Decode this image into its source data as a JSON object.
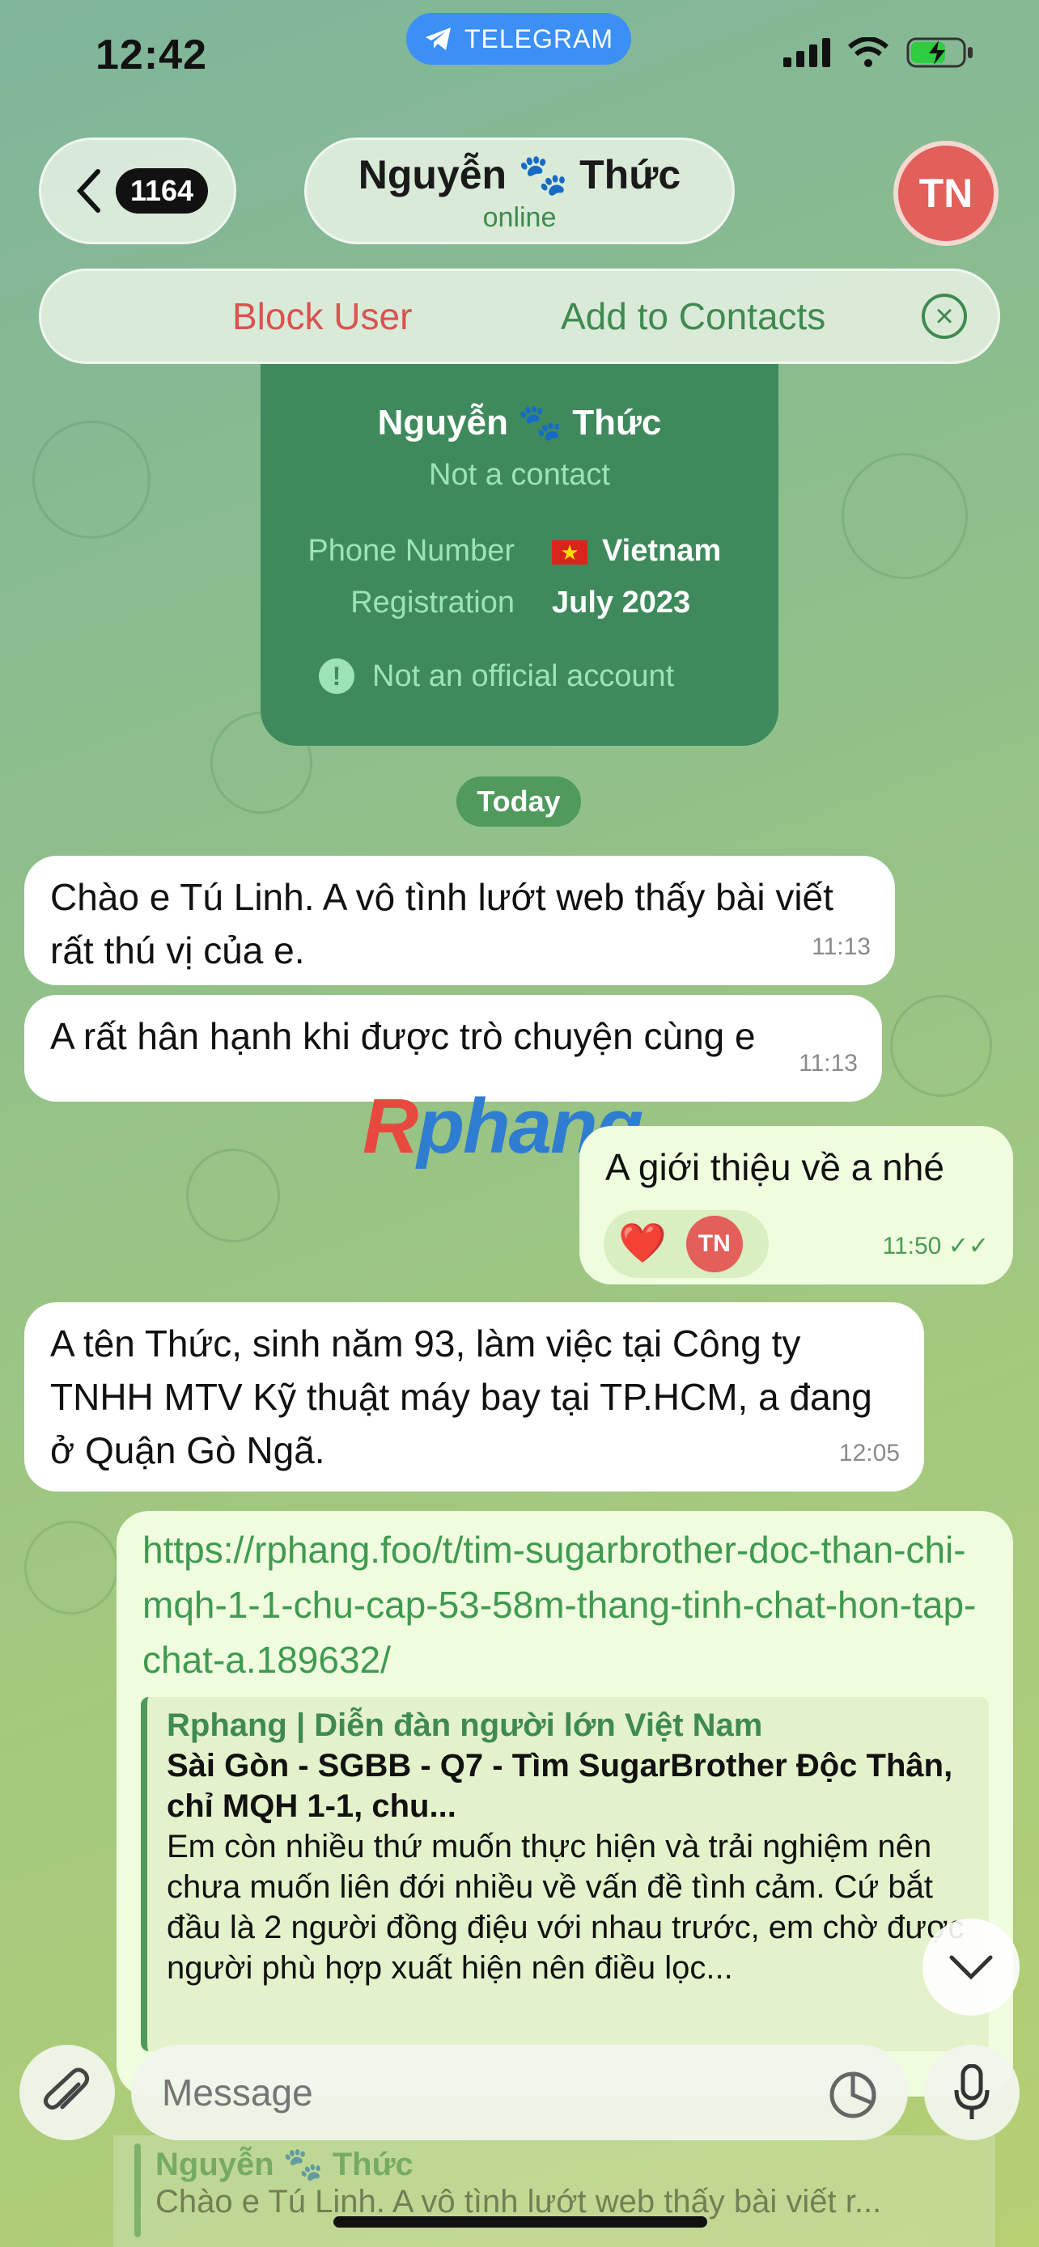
{
  "status_bar": {
    "time": "12:42",
    "app_pill": "TELEGRAM"
  },
  "header": {
    "unread_count": "1164",
    "contact_name": "Nguyễn 🐾 Thức",
    "contact_status": "online",
    "avatar_initials": "TN"
  },
  "action_bar": {
    "block_label": "Block User",
    "add_label": "Add to Contacts"
  },
  "info_card": {
    "name": "Nguyễn 🐾 Thức",
    "subtitle": "Not a contact",
    "phone_label": "Phone Number",
    "phone_value": "Vietnam",
    "registration_label": "Registration",
    "registration_value": "July 2023",
    "official_note": "Not an official account"
  },
  "date_separator": "Today",
  "messages": [
    {
      "text": "Chào e Tú Linh. A vô tình lướt web thấy bài viết rất thú vị của e.",
      "time": "11:13"
    },
    {
      "text": "A rất hân hạnh khi được trò chuyện cùng e",
      "time": "11:13"
    },
    {
      "text": "A giới thiệu về a nhé",
      "time": "11:50",
      "reaction": "❤️",
      "reaction_initials": "TN"
    },
    {
      "text": "A tên Thức, sinh năm 93, làm việc tại Công ty TNHH MTV Kỹ thuật máy bay tại TP.HCM, a đang ở Quận Gò Ngã.",
      "time": "12:05"
    }
  ],
  "link_message": {
    "url": "https://rphang.foo/t/tim-sugarbrother-doc-than-chi-mqh-1-1-chu-cap-53-58m-thang-tinh-chat-hon-tap-chat-a.189632/",
    "site": "Rphang | Diễn đàn người lớn Việt Nam",
    "title": "Sài Gòn - SGBB - Q7 - Tìm SugarBrother Độc Thân, chỉ MQH 1-1, chu...",
    "description": "Em còn nhiều thứ muốn thực hiện và trải nghiệm nên chưa muốn liên đới nhiều về vấn đề tình cảm. Cứ bắt đầu là 2 người đồng điệu với nhau trước, em chờ được người phù hợp xuất hiện nên điều lọc..."
  },
  "watermark": {
    "part1": "R",
    "part2": "phang"
  },
  "reply_preview": {
    "name": "Nguyễn 🐾 Thức",
    "text": "Chào e Tú Linh. A vô tình lướt web thấy bài viết r..."
  },
  "input": {
    "placeholder": "Message"
  },
  "colors": {
    "accent_green": "#3f8a4f",
    "block_red": "#d9534f",
    "telegram_blue": "#3b8ff5",
    "avatar_red": "#e35f5a"
  }
}
